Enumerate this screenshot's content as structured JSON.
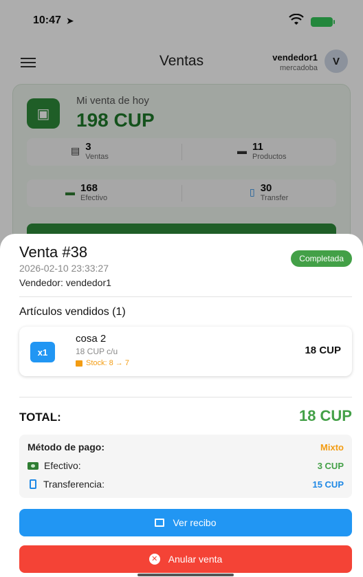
{
  "status_bar": {
    "time": "10:47"
  },
  "app_bar": {
    "title": "Ventas",
    "user_name": "vendedor1",
    "user_org": "mercadoba",
    "avatar_letter": "V"
  },
  "summary": {
    "today_label": "Mi venta de hoy",
    "today_amount": "198 CUP",
    "stats": [
      {
        "value": "3",
        "label": "Ventas",
        "icon": "receipt-icon"
      },
      {
        "value": "11",
        "label": "Productos",
        "icon": "box-icon"
      },
      {
        "value": "168",
        "label": "Efectivo",
        "icon": "cash-icon"
      },
      {
        "value": "30",
        "label": "Transfer",
        "icon": "phone-icon"
      }
    ]
  },
  "sale": {
    "title": "Venta #38",
    "date": "2026-02-10 23:33:27",
    "vendor": "Vendedor: vendedor1",
    "status": "Completada",
    "items_heading": "Artículos vendidos (1)",
    "items": [
      {
        "qty": "x1",
        "name": "cosa 2",
        "unit_price": "18 CUP c/u",
        "stock": "Stock: 8 → 7",
        "total": "18 CUP"
      }
    ],
    "total_label": "TOTAL:",
    "total_value": "18 CUP",
    "payment": {
      "method_label": "Método de pago:",
      "method_value": "Mixto",
      "cash_label": "Efectivo:",
      "cash_value": "3 CUP",
      "transfer_label": "Transferencia:",
      "transfer_value": "15 CUP"
    },
    "actions": {
      "receipt": "Ver recibo",
      "cancel": "Anular venta"
    }
  },
  "colors": {
    "accent_green": "#43a047",
    "accent_blue": "#2196f3",
    "danger_red": "#f44336",
    "warning_orange": "#f39c12"
  }
}
